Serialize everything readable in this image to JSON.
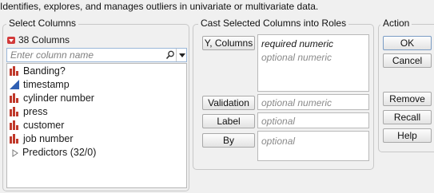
{
  "description": "Identifies, explores, and manages outliers in univariate or multivariate data.",
  "select_columns": {
    "title": "Select Columns",
    "count_label": "38 Columns",
    "search_placeholder": "Enter column name",
    "items": [
      {
        "label": "Banding?",
        "icon": "nominal-bar-icon",
        "color": "#c0392b"
      },
      {
        "label": "timestamp",
        "icon": "continuous-triangle-icon",
        "color": "#2f5fb3"
      },
      {
        "label": "cylinder number",
        "icon": "nominal-bar-icon",
        "color": "#c0392b"
      },
      {
        "label": "press",
        "icon": "nominal-bar-icon",
        "color": "#c0392b"
      },
      {
        "label": "customer",
        "icon": "nominal-bar-icon",
        "color": "#c0392b"
      },
      {
        "label": "job number",
        "icon": "nominal-bar-icon",
        "color": "#c0392b"
      },
      {
        "label": "Predictors (32/0)",
        "icon": "expand-triangle-icon",
        "color": "#777777"
      }
    ]
  },
  "cast": {
    "title": "Cast Selected Columns into Roles",
    "roles": [
      {
        "label": "Y, Columns",
        "required": "required numeric",
        "optional": "optional numeric"
      },
      {
        "label": "Validation",
        "optional": "optional numeric"
      },
      {
        "label": "Label",
        "optional": "optional"
      },
      {
        "label": "By",
        "optional": "optional"
      }
    ]
  },
  "action": {
    "title": "Action",
    "buttons": [
      "OK",
      "Cancel",
      "Remove",
      "Recall",
      "Help"
    ]
  }
}
